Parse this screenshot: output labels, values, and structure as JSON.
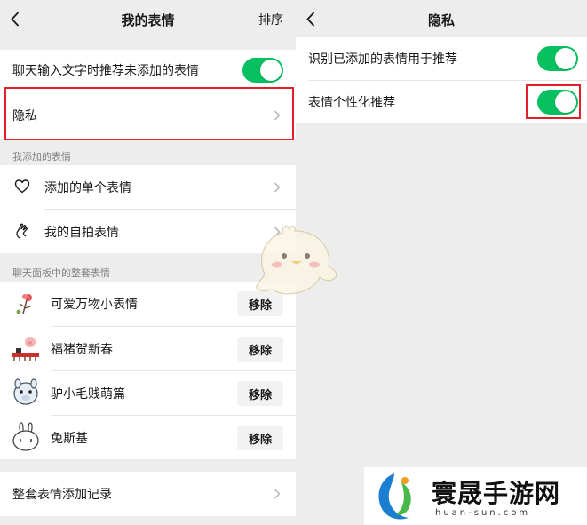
{
  "left": {
    "nav": {
      "title": "我的表情",
      "action": "排序"
    },
    "recommend_label": "聊天输入文字时推荐未添加的表情",
    "privacy_label": "隐私",
    "section_added": "我添加的表情",
    "added_items": [
      {
        "label": "添加的单个表情",
        "icon": "heart-outline-icon"
      },
      {
        "label": "我的自拍表情",
        "icon": "selfie-hand-icon"
      }
    ],
    "section_sets": "聊天面板中的整套表情",
    "sets": [
      {
        "name": "可爱万物小表情",
        "remove": "移除"
      },
      {
        "name": "福猪贺新春",
        "remove": "移除"
      },
      {
        "name": "驴小毛贱萌篇",
        "remove": "移除"
      },
      {
        "name": "兔斯基",
        "remove": "移除"
      }
    ],
    "history_label": "整套表情添加记录"
  },
  "right": {
    "nav": {
      "title": "隐私"
    },
    "items": [
      {
        "label": "识别已添加的表情用于推荐",
        "on": true
      },
      {
        "label": "表情个性化推荐",
        "on": true
      }
    ]
  },
  "watermark": {
    "name": "寰晟手游网",
    "url": "huan-sun.com"
  },
  "colors": {
    "toggle_on": "#07c160",
    "highlight": "#e0212a",
    "background": "#ededed"
  }
}
